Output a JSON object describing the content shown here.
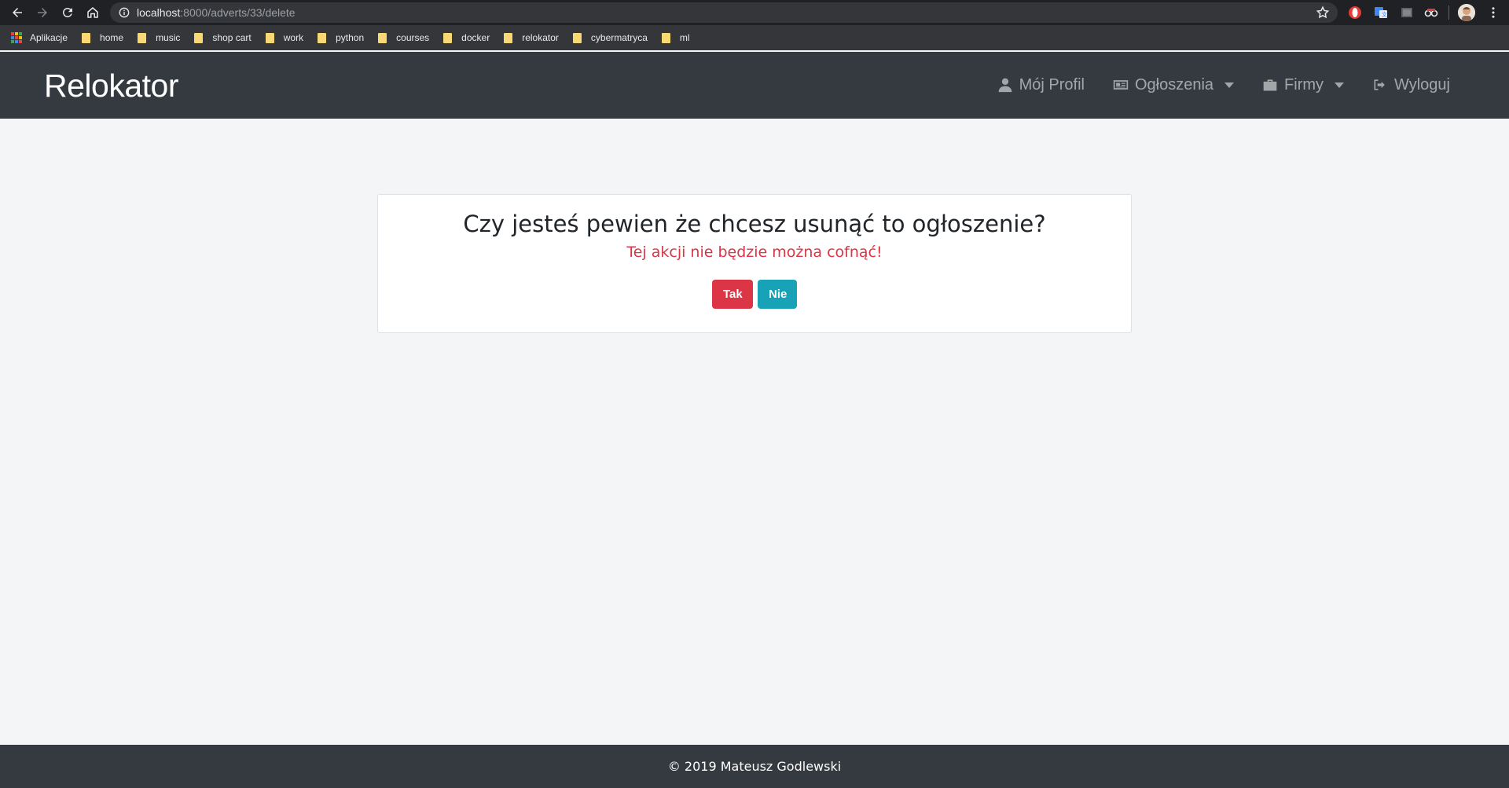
{
  "browser": {
    "url_host": "localhost",
    "url_path": ":8000/adverts/33/delete",
    "bookmarks": [
      {
        "label": "Aplikacje",
        "type": "apps"
      },
      {
        "label": "home",
        "type": "folder"
      },
      {
        "label": "music",
        "type": "folder"
      },
      {
        "label": "shop cart",
        "type": "folder"
      },
      {
        "label": "work",
        "type": "folder"
      },
      {
        "label": "python",
        "type": "folder"
      },
      {
        "label": "courses",
        "type": "folder"
      },
      {
        "label": "docker",
        "type": "folder"
      },
      {
        "label": "relokator",
        "type": "folder"
      },
      {
        "label": "cybermatryca",
        "type": "folder"
      },
      {
        "label": "ml",
        "type": "folder"
      }
    ]
  },
  "navbar": {
    "brand": "Relokator",
    "items": [
      {
        "label": "Mój Profil",
        "icon": "user-icon",
        "dropdown": false
      },
      {
        "label": "Ogłoszenia",
        "icon": "newspaper-icon",
        "dropdown": true
      },
      {
        "label": "Firmy",
        "icon": "briefcase-icon",
        "dropdown": true
      },
      {
        "label": "Wyloguj",
        "icon": "sign-out-icon",
        "dropdown": false
      }
    ]
  },
  "confirm": {
    "question": "Czy jesteś pewien że chcesz usunąć to ogłoszenie?",
    "warning": "Tej akcji nie będzie można cofnąć!",
    "yes_label": "Tak",
    "no_label": "Nie"
  },
  "footer": {
    "text": "© 2019 Mateusz Godlewski"
  },
  "colors": {
    "navbar_bg": "#343a40",
    "danger": "#dc3545",
    "info": "#17a2b8",
    "page_bg": "#f4f5f7"
  }
}
